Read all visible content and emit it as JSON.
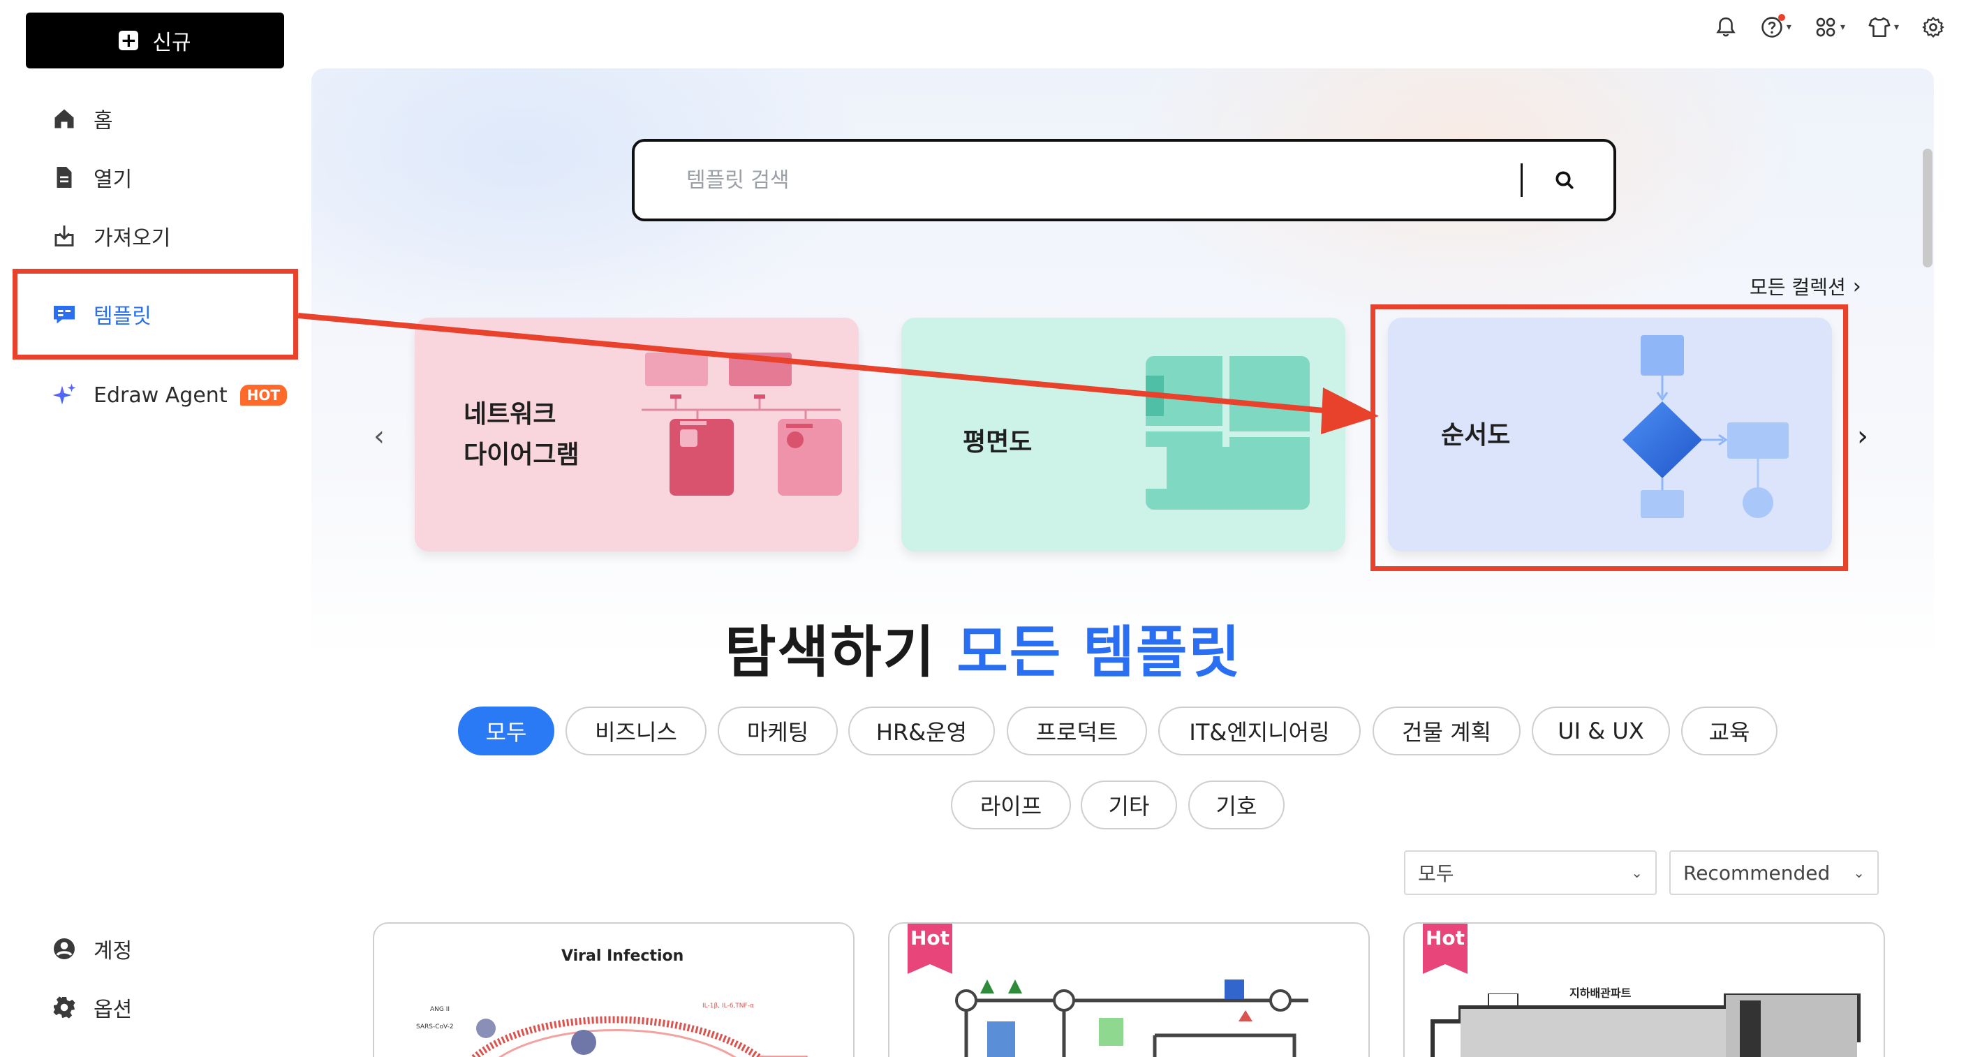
{
  "sidebar": {
    "new_label": "신규",
    "items": [
      {
        "label": "홈"
      },
      {
        "label": "열기"
      },
      {
        "label": "가져오기"
      },
      {
        "label": "템플릿"
      },
      {
        "label": "Edraw Agent",
        "badge": "HOT"
      }
    ],
    "bottom_items": [
      {
        "label": "계정"
      },
      {
        "label": "옵션"
      }
    ]
  },
  "header_icons": [
    "bell-icon",
    "help-icon",
    "apps-icon",
    "theme-icon",
    "settings-icon"
  ],
  "search": {
    "placeholder": "템플릿 검색"
  },
  "collections": {
    "all_label": "모든 컬렉션"
  },
  "cards": [
    {
      "title_line1": "네트워크",
      "title_line2": "다이어그램"
    },
    {
      "title": "평면도"
    },
    {
      "title": "순서도"
    }
  ],
  "explore": {
    "prefix": "탐색하기",
    "accent": "모든 템플릿"
  },
  "categories": [
    "모두",
    "비즈니스",
    "마케팅",
    "HR&운영",
    "프로덕트",
    "IT&엔지니어링",
    "건물 계획",
    "UI & UX",
    "교육",
    "라이프",
    "기타",
    "기호"
  ],
  "filters": {
    "type": "모두",
    "sort": "Recommended"
  },
  "templates": [
    {
      "title": "Viral Infection",
      "hot": false
    },
    {
      "title": "",
      "hot": true,
      "badge": "Hot"
    },
    {
      "title": "지하배관파트",
      "hot": true,
      "badge": "Hot"
    }
  ],
  "colors": {
    "accent": "#2a7af5",
    "annotation": "#e8412c",
    "hot": "#ff6a2b"
  }
}
